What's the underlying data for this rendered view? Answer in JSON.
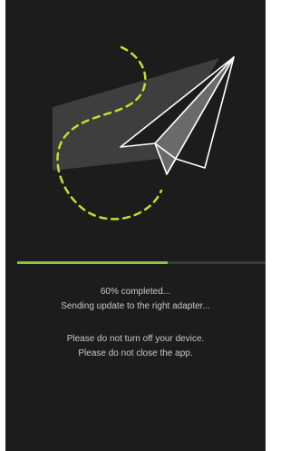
{
  "progress": {
    "fraction": 0.6,
    "status_line_1": "60% completed...",
    "status_line_2": "Sending update to the right adapter..."
  },
  "warnings": {
    "line_1": "Please do not turn off your device.",
    "line_2": "Please do not close the app."
  },
  "colors": {
    "background": "#1c1c1c",
    "accent": "#8cc63f",
    "text": "#c8c8c8",
    "track": "#3a3a3a"
  },
  "icons": [
    "paper-plane-icon",
    "dashed-flight-path"
  ]
}
